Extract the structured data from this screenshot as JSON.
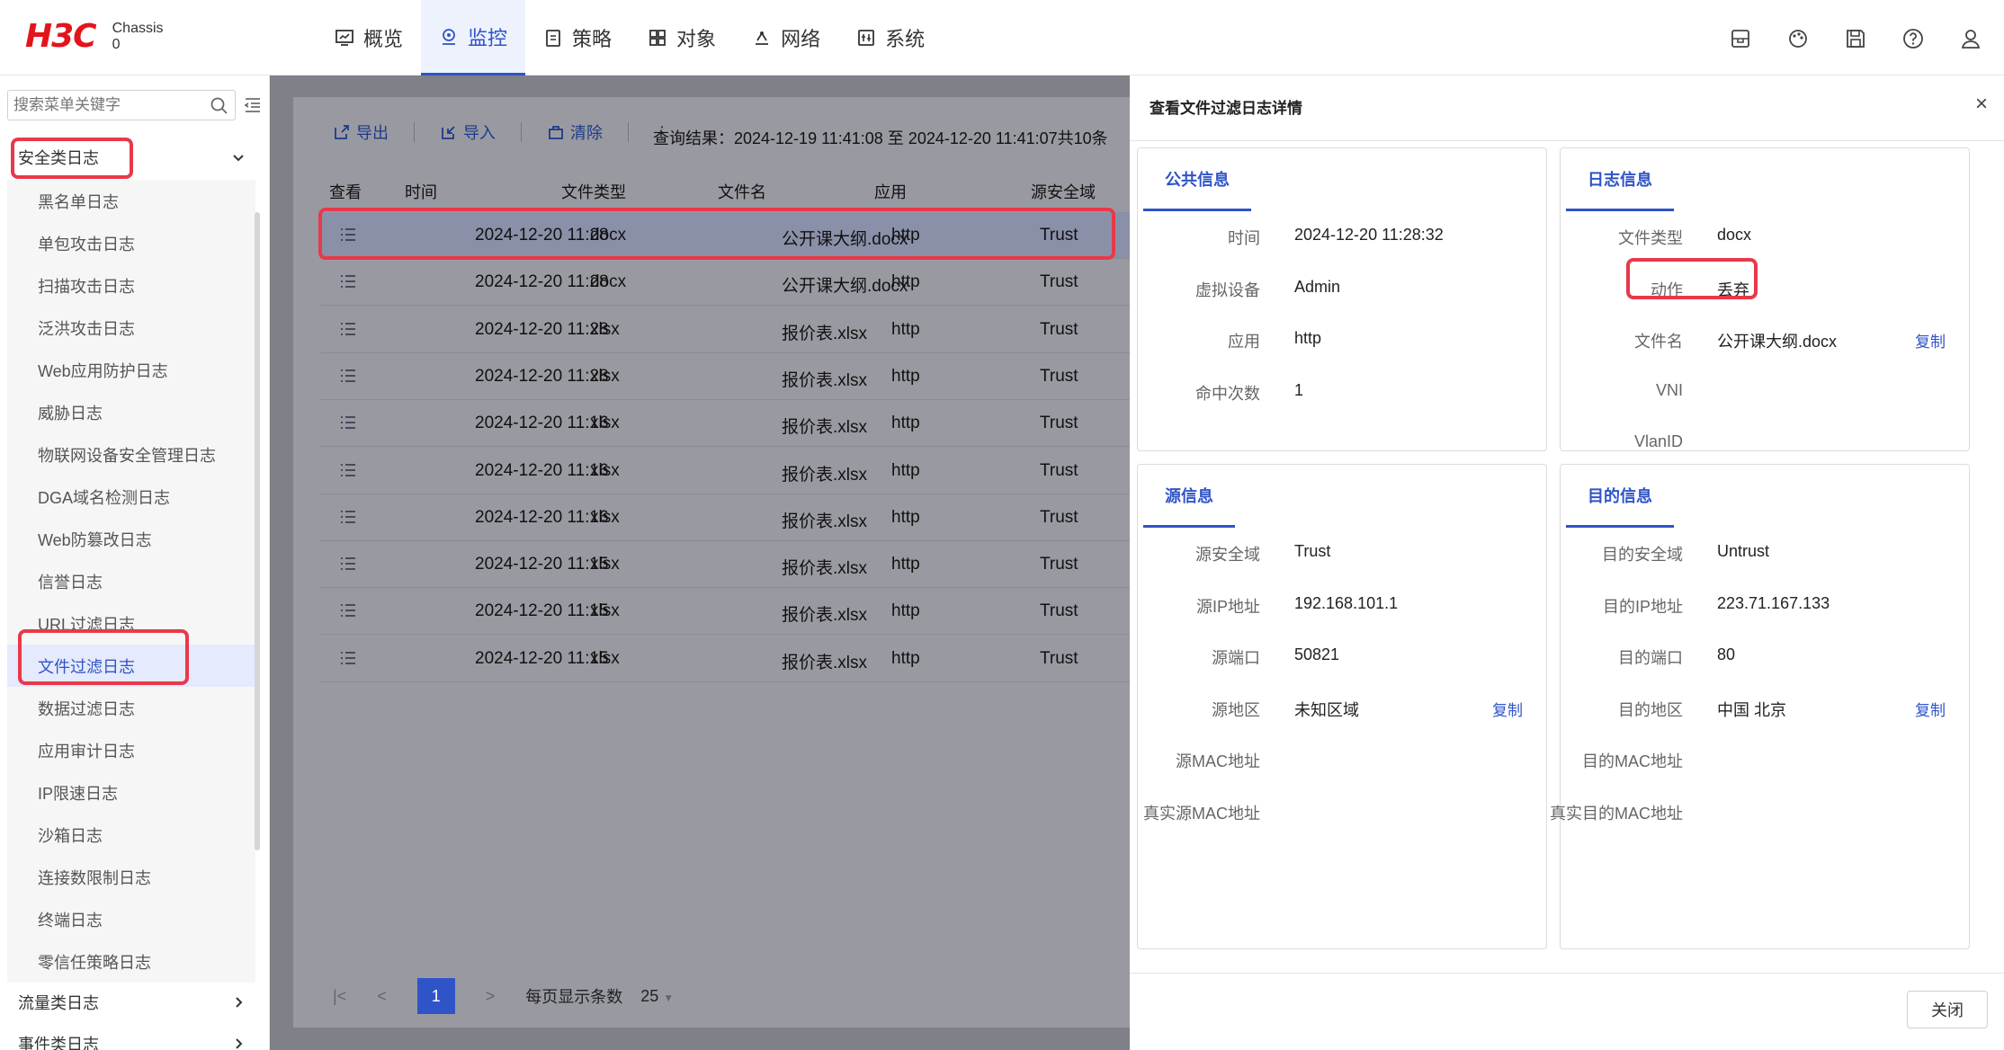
{
  "header": {
    "logo": "H3C",
    "logo_sub_1": "Chassis",
    "logo_sub_2": "0",
    "nav": [
      {
        "label": "概览",
        "icon": "overview-icon"
      },
      {
        "label": "监控",
        "icon": "monitor-icon",
        "active": true
      },
      {
        "label": "策略",
        "icon": "policy-icon"
      },
      {
        "label": "对象",
        "icon": "object-icon"
      },
      {
        "label": "网络",
        "icon": "network-icon"
      },
      {
        "label": "系统",
        "icon": "system-icon"
      }
    ],
    "icons": [
      "save-config-icon",
      "palette-icon",
      "save-icon",
      "help-icon",
      "user-icon"
    ]
  },
  "sidebar": {
    "search_placeholder": "搜索菜单关键字",
    "group_security": "安全类日志",
    "items": [
      "黑名单日志",
      "单包攻击日志",
      "扫描攻击日志",
      "泛洪攻击日志",
      "Web应用防护日志",
      "威胁日志",
      "物联网设备安全管理日志",
      "DGA域名检测日志",
      "Web防篡改日志",
      "信誉日志",
      "URL过滤日志",
      "文件过滤日志",
      "数据过滤日志",
      "应用审计日志",
      "IP限速日志",
      "沙箱日志",
      "连接数限制日志",
      "终端日志",
      "零信任策略日志"
    ],
    "active_item": "文件过滤日志",
    "group_traffic": "流量类日志",
    "group_event": "事件类日志"
  },
  "toolbar": {
    "export": "导出",
    "import": "导入",
    "clear": "清除",
    "more": "⋮",
    "query": "查询结果：2024-12-19 11:41:08 至 2024-12-20 11:41:07共10条"
  },
  "table": {
    "headers": [
      "查看",
      "时间",
      "文件类型",
      "文件名",
      "应用",
      "源安全域"
    ],
    "rows": [
      [
        "2024-12-20 11:28",
        "docx",
        "公开课大纲.docx",
        "http",
        "Trust"
      ],
      [
        "2024-12-20 11:28",
        "docx",
        "公开课大纲.docx",
        "http",
        "Trust"
      ],
      [
        "2024-12-20 11:28",
        "xlsx",
        "报价表.xlsx",
        "http",
        "Trust"
      ],
      [
        "2024-12-20 11:28",
        "xlsx",
        "报价表.xlsx",
        "http",
        "Trust"
      ],
      [
        "2024-12-20 11:16",
        "xlsx",
        "报价表.xlsx",
        "http",
        "Trust"
      ],
      [
        "2024-12-20 11:16",
        "xlsx",
        "报价表.xlsx",
        "http",
        "Trust"
      ],
      [
        "2024-12-20 11:16",
        "xlsx",
        "报价表.xlsx",
        "http",
        "Trust"
      ],
      [
        "2024-12-20 11:15",
        "xlsx",
        "报价表.xlsx",
        "http",
        "Trust"
      ],
      [
        "2024-12-20 11:15",
        "xlsx",
        "报价表.xlsx",
        "http",
        "Trust"
      ],
      [
        "2024-12-20 11:15",
        "xlsx",
        "报价表.xlsx",
        "http",
        "Trust"
      ]
    ]
  },
  "pager": {
    "first": "|<",
    "prev": "<",
    "page": "1",
    "next": ">",
    "per_page_label": "每页显示条数",
    "per_page": "25"
  },
  "drawer": {
    "title": "查看文件过滤日志详情",
    "close_x": "×",
    "copy": "复制",
    "public": {
      "tab": "公共信息",
      "rows": [
        [
          "时间",
          "2024-12-20 11:28:32"
        ],
        [
          "虚拟设备",
          "Admin"
        ],
        [
          "应用",
          "http"
        ],
        [
          "命中次数",
          "1"
        ]
      ]
    },
    "log": {
      "tab": "日志信息",
      "rows": [
        [
          "文件类型",
          "docx"
        ],
        [
          "动作",
          "丢弃"
        ],
        [
          "文件名",
          "公开课大纲.docx"
        ],
        [
          "VNI",
          ""
        ],
        [
          "VlanID",
          ""
        ]
      ]
    },
    "source": {
      "tab": "源信息",
      "rows": [
        [
          "源安全域",
          "Trust"
        ],
        [
          "源IP地址",
          "192.168.101.1"
        ],
        [
          "源端口",
          "50821"
        ],
        [
          "源地区",
          "未知区域"
        ],
        [
          "源MAC地址",
          ""
        ],
        [
          "真实源MAC地址",
          ""
        ]
      ]
    },
    "dest": {
      "tab": "目的信息",
      "rows": [
        [
          "目的安全域",
          "Untrust"
        ],
        [
          "目的IP地址",
          "223.71.167.133"
        ],
        [
          "目的端口",
          "80"
        ],
        [
          "目的地区",
          "中国 北京"
        ],
        [
          "目的MAC地址",
          ""
        ],
        [
          "真实目的MAC地址",
          ""
        ]
      ]
    },
    "close_button": "关闭"
  },
  "colors": {
    "accent": "#2f54c8",
    "brand": "#e3141c",
    "highlight": "#e8394a"
  }
}
